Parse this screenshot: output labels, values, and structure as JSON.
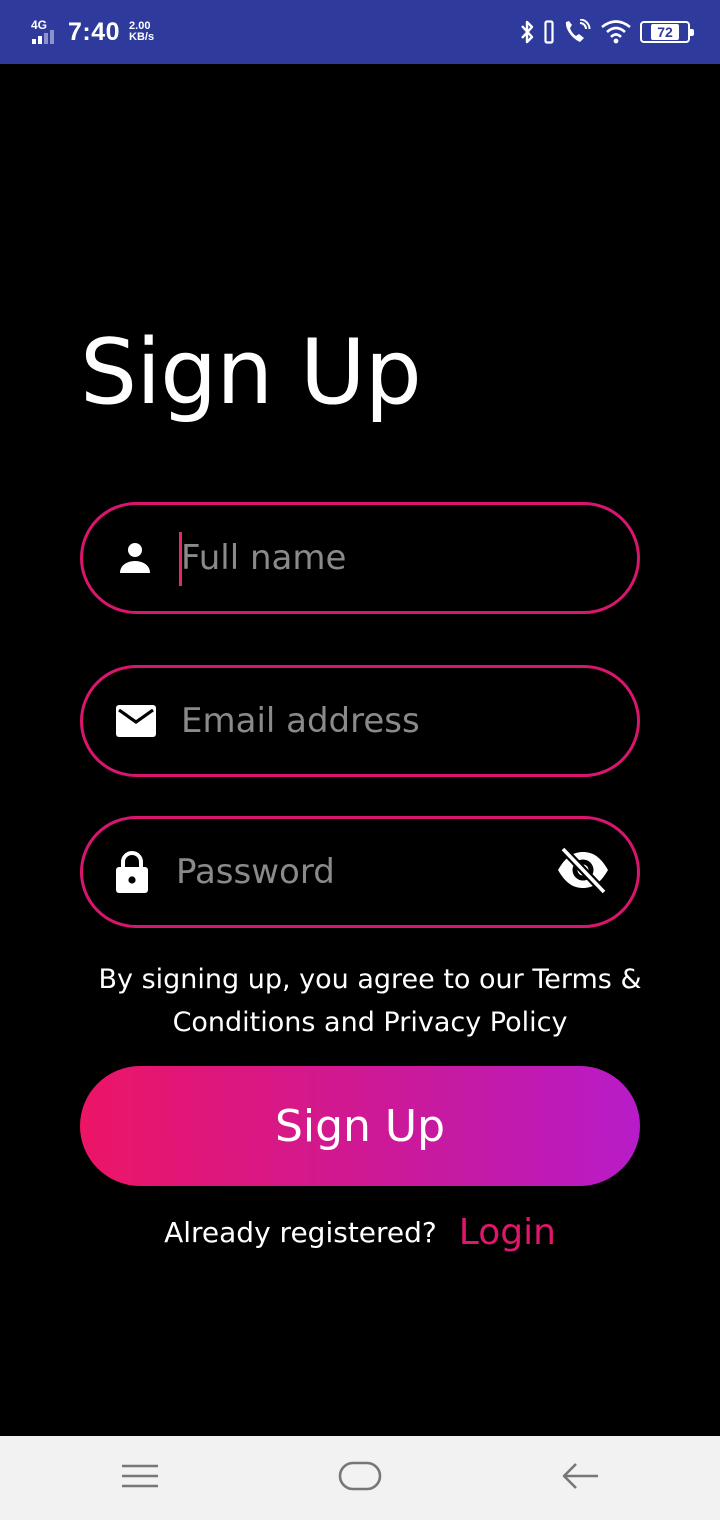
{
  "status_bar": {
    "network": "4G",
    "time": "7:40",
    "speed_value": "2.00",
    "speed_unit": "KB/s",
    "battery": "72",
    "icons": [
      "bluetooth-icon",
      "vibrate-icon",
      "wifi-calling-icon",
      "wifi-icon",
      "battery-icon"
    ]
  },
  "title": "Sign Up",
  "form": {
    "full_name": {
      "placeholder": "Full name",
      "value": "",
      "icon": "person-icon"
    },
    "email": {
      "placeholder": "Email address",
      "value": "",
      "icon": "mail-icon"
    },
    "password": {
      "placeholder": "Password",
      "value": "",
      "icon": "lock-icon",
      "toggle_icon": "eye-off-icon"
    }
  },
  "terms_text": "By signing up, you agree to our Terms & Conditions and Privacy Policy",
  "signup_button": "Sign Up",
  "login_prompt": "Already registered?",
  "login_link": "Login",
  "colors": {
    "accent": "#d9156f",
    "gradient_start": "#ec1566",
    "gradient_end": "#b81bc9",
    "status_bar": "#2f3b9c",
    "background": "#000000"
  },
  "nav_bar": {
    "icons": [
      "menu-icon",
      "home-icon",
      "back-icon"
    ]
  }
}
